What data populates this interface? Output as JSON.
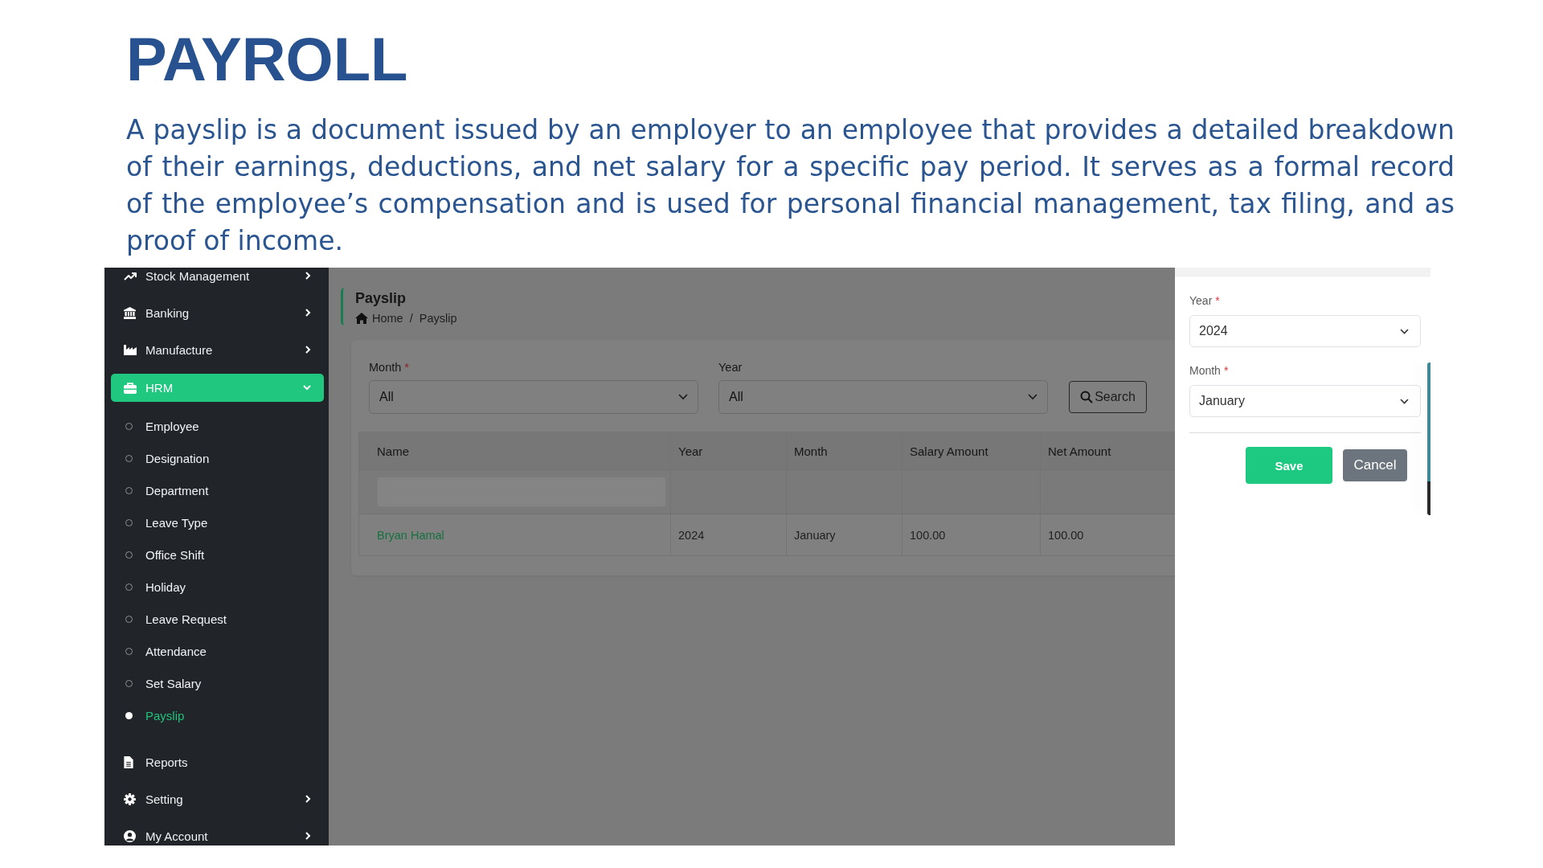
{
  "heading": {
    "title": "PAYROLL",
    "description": "A payslip is a document issued by an employer to an employee that provides a detailed breakdown of their earnings, deductions, and net salary for a specific pay period. It serves as a formal record of the employee’s compensation and is used for personal financial management, tax filing, and as proof of income."
  },
  "sidebar": {
    "items": [
      {
        "label": "Stock Management",
        "selected": false,
        "expanded": false
      },
      {
        "label": "Banking",
        "selected": false,
        "expanded": false
      },
      {
        "label": "Manufacture",
        "selected": false,
        "expanded": false
      },
      {
        "label": "HRM",
        "selected": true,
        "expanded": true,
        "children": [
          {
            "label": "Employee",
            "selected": false
          },
          {
            "label": "Designation",
            "selected": false
          },
          {
            "label": "Department",
            "selected": false
          },
          {
            "label": "Leave Type",
            "selected": false
          },
          {
            "label": "Office Shift",
            "selected": false
          },
          {
            "label": "Holiday",
            "selected": false
          },
          {
            "label": "Leave Request",
            "selected": false
          },
          {
            "label": "Attendance",
            "selected": false
          },
          {
            "label": "Set Salary",
            "selected": false
          },
          {
            "label": "Payslip",
            "selected": true
          }
        ]
      },
      {
        "label": "Reports",
        "selected": false
      },
      {
        "label": "Setting",
        "selected": false,
        "expanded": false
      },
      {
        "label": "My Account",
        "selected": false,
        "expanded": false
      }
    ]
  },
  "page": {
    "title": "Payslip",
    "breadcrumb": {
      "items": [
        "Home",
        "Payslip"
      ],
      "separator": "/"
    }
  },
  "filters": {
    "fields": [
      {
        "label": "Month",
        "required_mark": "*",
        "value": "All"
      },
      {
        "label": "Year",
        "value": "All"
      }
    ],
    "search_button": "Search"
  },
  "table": {
    "columns": [
      "Name",
      "Year",
      "Month",
      "Salary Amount",
      "Net Amount"
    ],
    "rows": [
      {
        "cells": [
          "Bryan Hamal",
          "2024",
          "January",
          "100.00",
          "100.00"
        ]
      }
    ]
  },
  "form": {
    "fields": [
      {
        "label": "Year",
        "required_mark": "*",
        "value": "2024"
      },
      {
        "label": "Month",
        "required_mark": "*",
        "value": "January"
      }
    ],
    "buttons": [
      {
        "label": "Save",
        "kind": "primary"
      },
      {
        "label": "Cancel",
        "kind": "secondary"
      }
    ]
  }
}
